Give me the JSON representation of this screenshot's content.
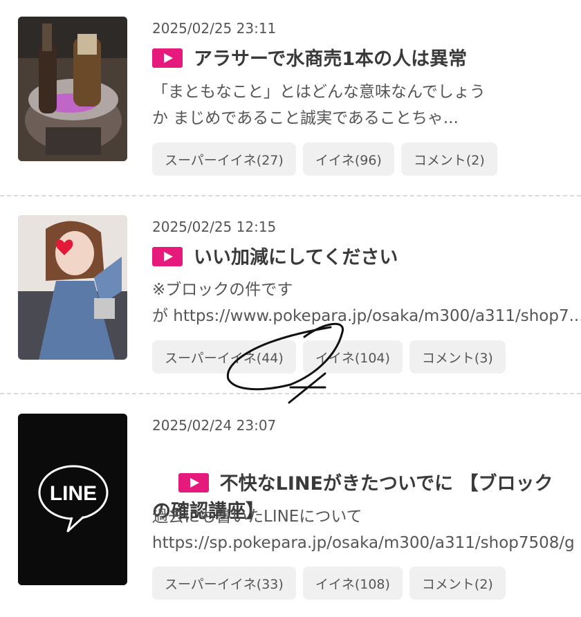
{
  "colors": {
    "accent": "#e6197d",
    "button_bg": "#f0f0f0"
  },
  "posts": [
    {
      "date": "2025/02/25 23:11",
      "title": "アラサーで水商売1本の人は異常",
      "excerpt": "「まともなこと」とはどんな意味なんでしょう\nか まじめであること誠実であることちゃ...",
      "thumb": "champagne-photo",
      "buttons": [
        "スーパーイイネ(27)",
        "イイネ(96)",
        "コメント(2)"
      ]
    },
    {
      "date": "2025/02/25 12:15",
      "title": "いい加減にしてください",
      "excerpt": "※ブロックの件です\nが https://www.pokepara.jp/osaka/m300/a311/shop7...",
      "thumb": "woman-photo",
      "buttons": [
        "スーパーイイネ(44)",
        "イイネ(104)",
        "コメント(3)"
      ]
    },
    {
      "date": "2025/02/24 23:07",
      "title": "不快なLINEがきたついでに 【ブロック\nの確認講座】",
      "excerpt": "過去にも書いたLINEについて\nhttps://sp.pokepara.jp/osaka/m300/a311/shop7508/g",
      "thumb": "line-logo",
      "thumb_text": "LINE",
      "buttons": [
        "スーパーイイネ(33)",
        "イイネ(108)",
        "コメント(2)"
      ]
    }
  ]
}
